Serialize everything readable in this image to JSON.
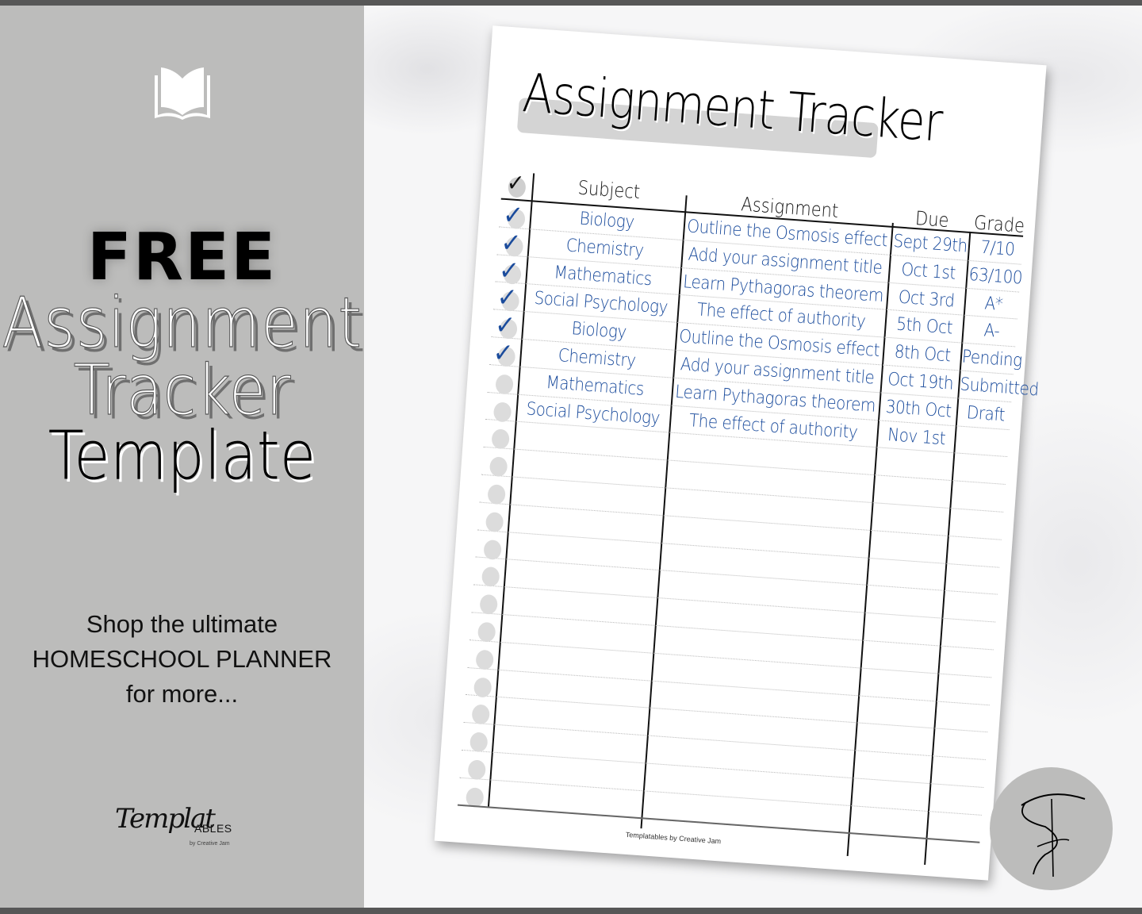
{
  "left_panel": {
    "icon": "open-book-icon",
    "headline": "FREE",
    "title_line1": "Assignment",
    "title_line2": "Tracker",
    "title_line3": "Template",
    "promo_line1": "Shop the ultimate",
    "promo_line2": "HOMESCHOOL PLANNER",
    "promo_line3": "for more...",
    "brand_script": "Templat",
    "brand_caps": "ABLES",
    "brand_sub": "by Creative Jam"
  },
  "paper": {
    "title": "Assignment Tracker",
    "headers": {
      "check": "✓",
      "subject": "Subject",
      "assignment": "Assignment",
      "due": "Due",
      "grade": "Grade"
    },
    "rows": [
      {
        "done": true,
        "subject": "Biology",
        "assignment": "Outline the Osmosis effect",
        "due": "Sept 29th",
        "grade": "7/10"
      },
      {
        "done": true,
        "subject": "Chemistry",
        "assignment": "Add your assignment title",
        "due": "Oct 1st",
        "grade": "63/100"
      },
      {
        "done": true,
        "subject": "Mathematics",
        "assignment": "Learn Pythagoras theorem",
        "due": "Oct 3rd",
        "grade": "A*"
      },
      {
        "done": true,
        "subject": "Social Psychology",
        "assignment": "The effect of authority",
        "due": "5th Oct",
        "grade": "A-"
      },
      {
        "done": true,
        "subject": "Biology",
        "assignment": "Outline the Osmosis effect",
        "due": "8th Oct",
        "grade": "Pending"
      },
      {
        "done": true,
        "subject": "Chemistry",
        "assignment": "Add your assignment title",
        "due": "Oct 19th",
        "grade": "Submitted"
      },
      {
        "done": false,
        "subject": "Mathematics",
        "assignment": "Learn Pythagoras theorem",
        "due": "30th Oct",
        "grade": "Draft"
      },
      {
        "done": false,
        "subject": "Social Psychology",
        "assignment": "The effect of authority",
        "due": "Nov 1st",
        "grade": ""
      },
      {
        "done": false,
        "subject": "",
        "assignment": "",
        "due": "",
        "grade": ""
      },
      {
        "done": false,
        "subject": "",
        "assignment": "",
        "due": "",
        "grade": ""
      },
      {
        "done": false,
        "subject": "",
        "assignment": "",
        "due": "",
        "grade": ""
      },
      {
        "done": false,
        "subject": "",
        "assignment": "",
        "due": "",
        "grade": ""
      },
      {
        "done": false,
        "subject": "",
        "assignment": "",
        "due": "",
        "grade": ""
      },
      {
        "done": false,
        "subject": "",
        "assignment": "",
        "due": "",
        "grade": ""
      },
      {
        "done": false,
        "subject": "",
        "assignment": "",
        "due": "",
        "grade": ""
      },
      {
        "done": false,
        "subject": "",
        "assignment": "",
        "due": "",
        "grade": ""
      },
      {
        "done": false,
        "subject": "",
        "assignment": "",
        "due": "",
        "grade": ""
      },
      {
        "done": false,
        "subject": "",
        "assignment": "",
        "due": "",
        "grade": ""
      },
      {
        "done": false,
        "subject": "",
        "assignment": "",
        "due": "",
        "grade": ""
      },
      {
        "done": false,
        "subject": "",
        "assignment": "",
        "due": "",
        "grade": ""
      },
      {
        "done": false,
        "subject": "",
        "assignment": "",
        "due": "",
        "grade": ""
      },
      {
        "done": false,
        "subject": "",
        "assignment": "",
        "due": "",
        "grade": ""
      }
    ],
    "footer": "Templatables by Creative Jam"
  },
  "logo": {
    "icon": "templatables-monogram-icon"
  },
  "colors": {
    "panel_grey": "#bcbcbb",
    "frame_dark": "#575757",
    "ink_blue": "#1a4b9c",
    "check_circle": "#dcdcdc"
  }
}
